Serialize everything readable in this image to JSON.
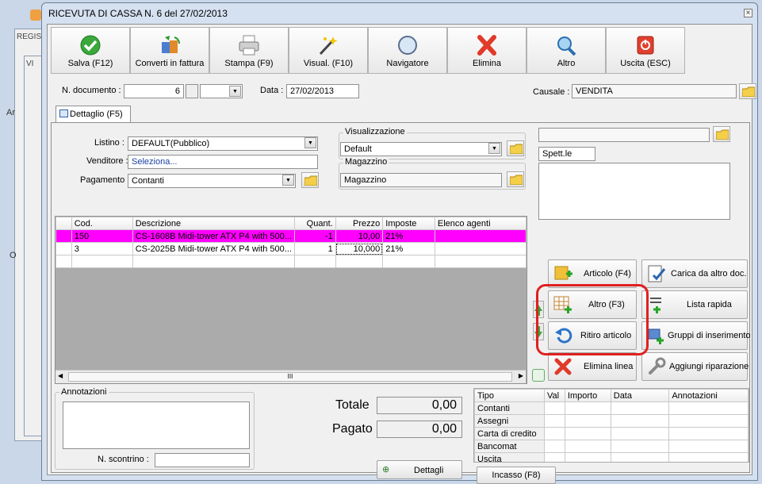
{
  "background": {
    "label_regis": "REGIS",
    "label_vi": "VI",
    "label_ar": "Ar",
    "label_o": "O"
  },
  "window": {
    "title": "RICEVUTA DI CASSA N. 6 del 27/02/2013",
    "close_glyph": "×"
  },
  "toolbar": [
    {
      "label": "Salva (F12)",
      "icon": "check-icon"
    },
    {
      "label": "Converti in fattura",
      "icon": "convert-icon"
    },
    {
      "label": "Stampa (F9)",
      "icon": "printer-icon"
    },
    {
      "label": "Visual. (F10)",
      "icon": "magic-wand-icon"
    },
    {
      "label": "Navigatore",
      "icon": "compass-icon"
    },
    {
      "label": "Elimina",
      "icon": "delete-x-icon"
    },
    {
      "label": "Altro",
      "icon": "magnifier-icon"
    },
    {
      "label": "Uscita (ESC)",
      "icon": "exit-icon"
    }
  ],
  "header": {
    "doc_label": "N. documento :",
    "doc_number": "6",
    "data_label": "Data :",
    "data_value": "27/02/2013",
    "causale_label": "Causale :",
    "causale_value": "VENDITA"
  },
  "tab": {
    "label": "Dettaglio (F5)"
  },
  "form": {
    "listino_label": "Listino :",
    "listino_value": "DEFAULT(Pubblico)",
    "venditore_label": "Venditore :",
    "venditore_value": "Seleziona...",
    "pagamento_label": "Pagamento :",
    "pagamento_value": "Contanti",
    "visual_label": "Visualizzazione",
    "visual_value": "Default",
    "magazzino_label": "Magazzino",
    "magazzino_value": "Magazzino",
    "cliente_value": "Spett.le"
  },
  "grid": {
    "columns": [
      "Cod.",
      "Descrizione",
      "Quant.",
      "Prezzo",
      "Imposte",
      "Elenco agenti"
    ],
    "rows": [
      {
        "cod": "150",
        "desc": "CS-1608B Midi-tower ATX P4 with 500...",
        "qty": "-1",
        "price": "10,00",
        "tax": "21%"
      },
      {
        "cod": "3",
        "desc": "CS-2025B Midi-tower ATX P4 with 500...",
        "qty": "1",
        "price": "10,000",
        "tax": "21%"
      }
    ],
    "scroll_thumb": "III",
    "highlight_color": "#ff00ff"
  },
  "actions": {
    "articolo": "Articolo (F4)",
    "carica": "Carica da altro doc.",
    "altro": "Altro (F3)",
    "lista": "Lista rapida",
    "ritiro": "Ritiro articolo",
    "gruppi": "Gruppi di inserimento",
    "elimina_linea": "Elimina linea",
    "riparazione": "Aggiungi riparazione"
  },
  "footer": {
    "annotazioni_label": "Annotazioni",
    "scontrino_label": "N. scontrino :",
    "totale_label": "Totale",
    "totale_value": "0,00",
    "pagato_label": "Pagato",
    "pagato_value": "0,00",
    "dettagli_label": "Dettagli",
    "incasso_label": "Incasso (F8)"
  },
  "payments": {
    "columns": [
      "Tipo",
      "Val",
      "Importo",
      "Data",
      "Annotazioni"
    ],
    "rows": [
      "Contanti",
      "Assegni",
      "Carta di credito",
      "Bancomat",
      "Uscita"
    ]
  }
}
